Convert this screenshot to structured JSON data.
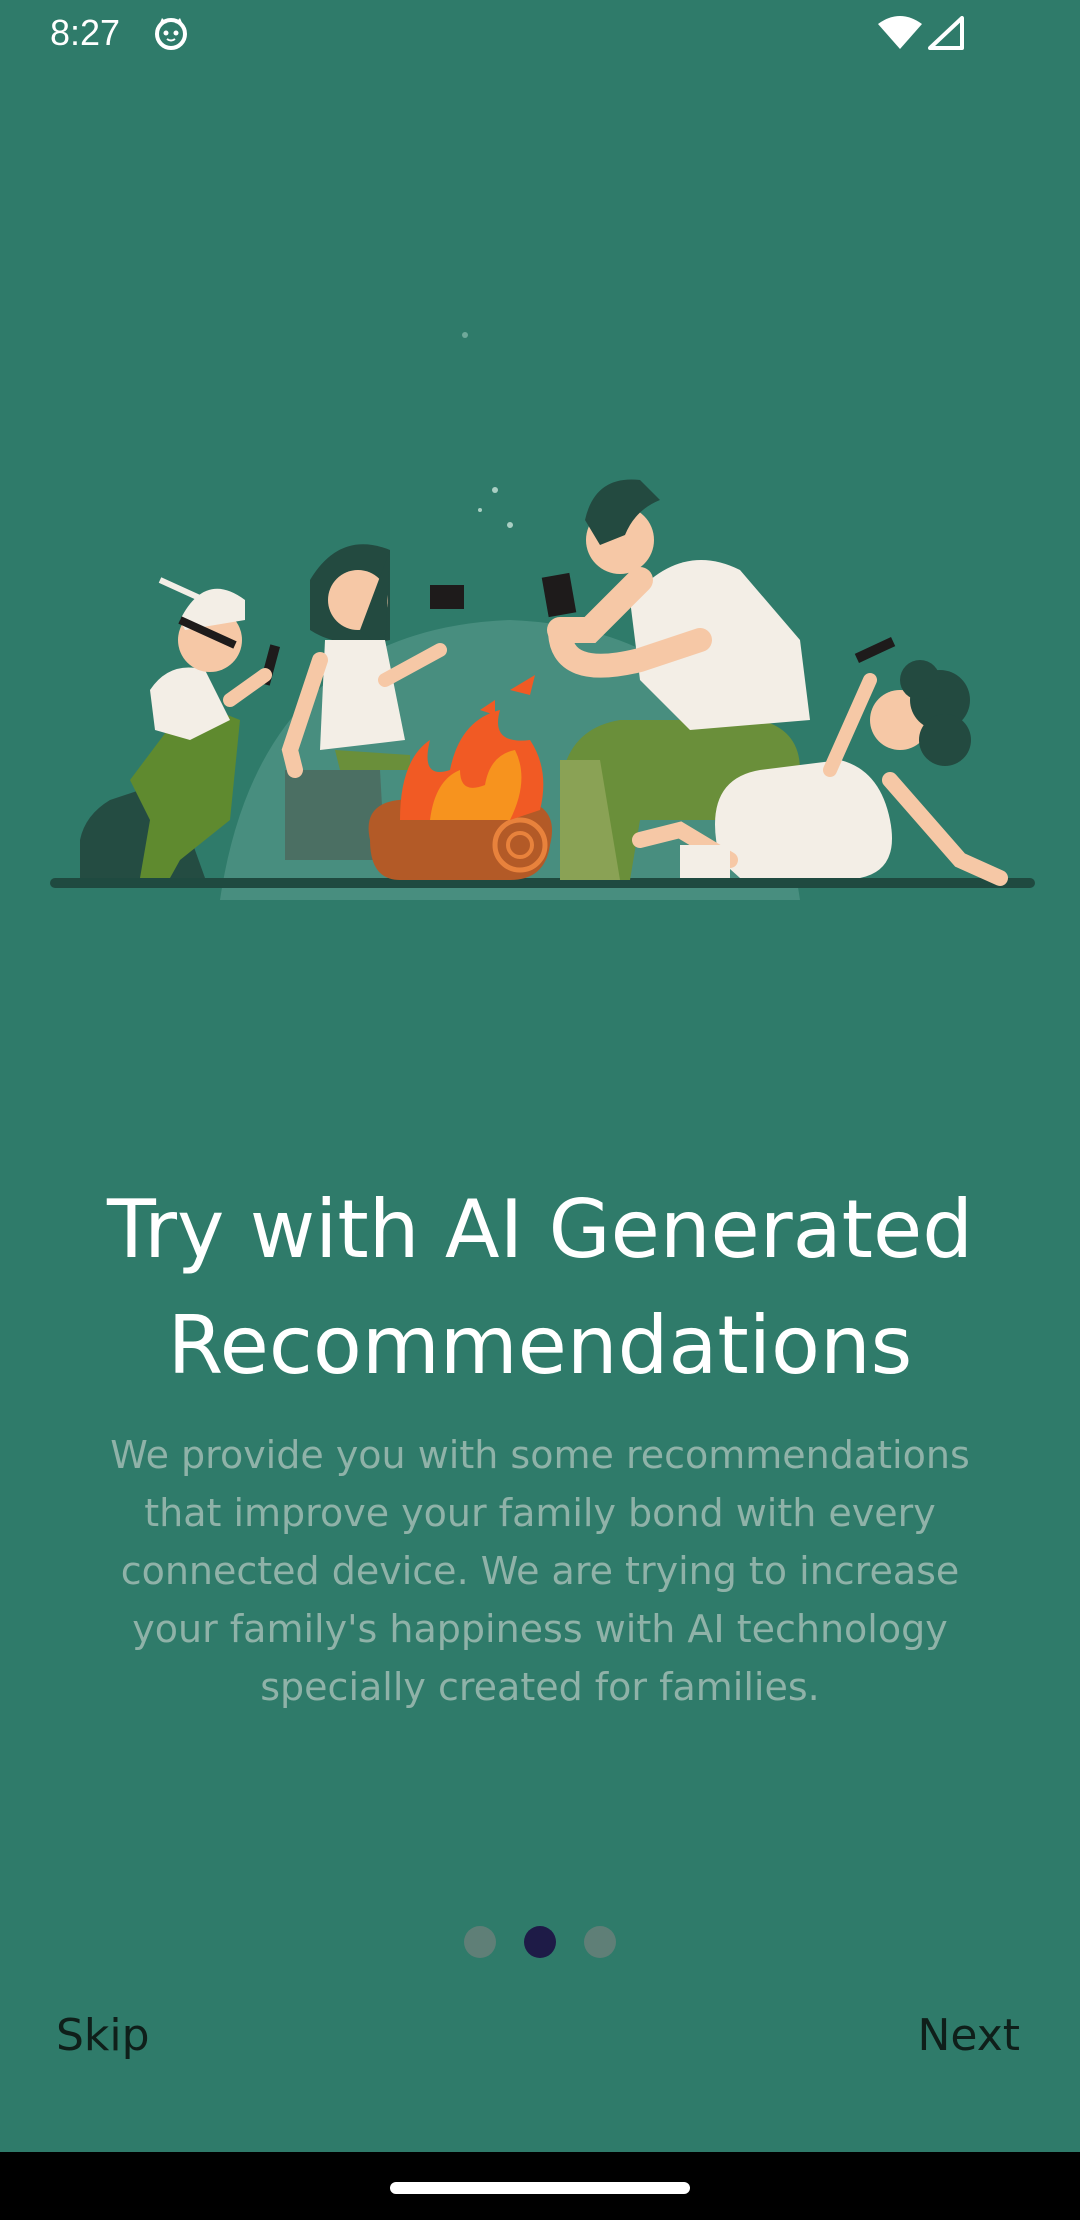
{
  "status_bar": {
    "time": "8:27",
    "app_icon": "cat-face-icon",
    "wifi_icon": "wifi-icon",
    "signal_icon": "signal-icon"
  },
  "illustration": {
    "name": "family-campfire-phones-illustration"
  },
  "onboarding": {
    "title": "Try with AI Generated Recommendations",
    "description": "We provide you with some recommendations that improve your family bond with every connected device. We are trying to increase your family's happiness with AI technology specially created for families.",
    "page_count": 3,
    "active_page": 2
  },
  "buttons": {
    "skip_label": "Skip",
    "next_label": "Next"
  },
  "colors": {
    "background": "#2f7b6a",
    "dot_active": "#1e1b47",
    "dot_inactive": "#5f7f77"
  }
}
